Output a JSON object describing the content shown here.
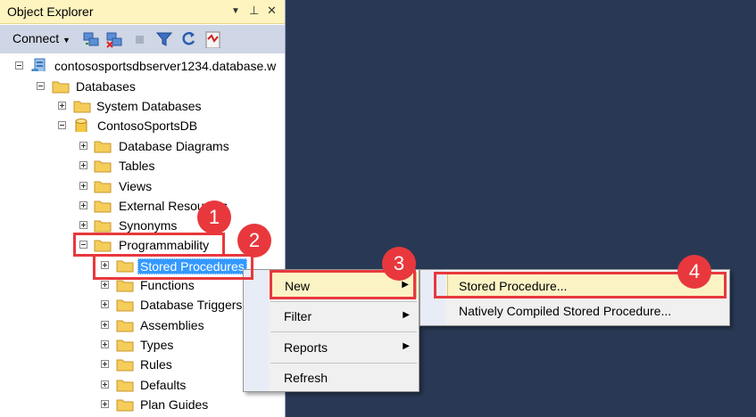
{
  "panel": {
    "title": "Object Explorer",
    "controls": {
      "dropdown": "▼",
      "pin": "⊥",
      "close": "✕"
    }
  },
  "toolbar": {
    "connect_label": "Connect"
  },
  "tree": {
    "server": "contososportsdbserver1234.database.w",
    "databases": "Databases",
    "system_databases": "System Databases",
    "database": "ContosoSportsDB",
    "db_children": [
      "Database Diagrams",
      "Tables",
      "Views",
      "External Resources",
      "Synonyms",
      "Programmability"
    ],
    "prog_children": [
      "Stored Procedures",
      "Functions",
      "Database Triggers",
      "Assemblies",
      "Types",
      "Rules",
      "Defaults",
      "Plan Guides"
    ]
  },
  "context_menu": {
    "items": [
      "New",
      "Filter",
      "Reports",
      "Refresh"
    ]
  },
  "submenu": {
    "items": [
      "Stored Procedure...",
      "Natively Compiled Stored Procedure..."
    ]
  },
  "badges": [
    "1",
    "2",
    "3",
    "4"
  ],
  "colors": {
    "accent_red": "#e8383d",
    "background": "#293955",
    "title_bar": "#fdf4bf",
    "selection": "#3399ff"
  }
}
